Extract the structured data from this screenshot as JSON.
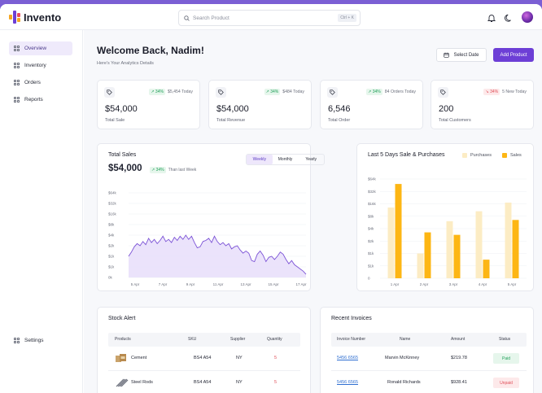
{
  "app": {
    "name": "Invento"
  },
  "search": {
    "placeholder": "Search Product",
    "shortcut": "Ctrl + K"
  },
  "sidebar": {
    "items": [
      {
        "label": "Overview",
        "icon": "grid-icon",
        "active": true
      },
      {
        "label": "Inventory",
        "icon": "grid-icon"
      },
      {
        "label": "Orders",
        "icon": "grid-icon"
      },
      {
        "label": "Reports",
        "icon": "grid-icon"
      }
    ],
    "settings": {
      "label": "Settings",
      "icon": "grid-icon"
    }
  },
  "header": {
    "title": "Welcome Back, Nadim!",
    "subtitle": "Here's Your Analytics Details",
    "select_date": "Select Date",
    "add_product": "Add Product"
  },
  "stats": [
    {
      "value": "$54,000",
      "label": "Total Sale",
      "trend": "34%",
      "direction": "up",
      "note": "$5,454 Today"
    },
    {
      "value": "$54,000",
      "label": "Total Revenue",
      "trend": "34%",
      "direction": "up",
      "note": "$484 Today"
    },
    {
      "value": "6,546",
      "label": "Total Order",
      "trend": "34%",
      "direction": "up",
      "note": "84 Orders Today"
    },
    {
      "value": "200",
      "label": "Total Customers",
      "trend": "34%",
      "direction": "down",
      "note": "5 New Today"
    }
  ],
  "total_sales": {
    "title": "Total Sales",
    "value": "$54,000",
    "trend": "34%",
    "trend_note": "Than last Week",
    "tabs": [
      "Weekly",
      "Monthly",
      "Yearly"
    ],
    "active_tab": "Weekly"
  },
  "bar_panel": {
    "title": "Last 5 Days Sale & Purchases",
    "legend": [
      "Purchases",
      "Sales"
    ]
  },
  "chart_data": [
    {
      "type": "area",
      "y_tick_labels": [
        "$64k",
        "$32k",
        "$16k",
        "$8k",
        "$4k",
        "$2k",
        "$1k",
        "$1k",
        "0k"
      ],
      "x_tick_labels": [
        "5 Apr",
        "7 Apr",
        "9 Apr",
        "11 Apr",
        "13 Apr",
        "15 Apr",
        "17 Apr"
      ],
      "y_scale": "categorical-log",
      "series": [
        {
          "values": [
            2.0,
            2.4,
            2.9,
            3.2,
            3.0,
            3.4,
            3.1,
            3.7,
            3.3,
            3.6,
            3.2,
            3.5,
            3.9,
            3.4,
            3.6,
            3.3,
            3.8,
            3.5,
            3.9,
            3.6,
            4.0,
            3.6,
            3.9,
            3.3,
            2.8,
            2.9,
            3.4,
            3.5,
            3.7,
            3.3,
            3.9,
            3.4,
            3.1,
            3.3,
            3.0,
            3.2,
            2.7,
            2.9,
            3.0,
            2.6,
            2.3,
            2.5,
            2.3,
            1.6,
            1.5,
            2.2,
            2.5,
            2.1,
            1.5,
            1.9,
            2.0,
            1.7,
            2.0,
            2.4,
            2.2,
            1.7,
            1.3,
            1.6,
            1.2,
            1.0,
            0.8,
            0.6,
            0.3
          ]
        }
      ],
      "line_color": "#7b52d6",
      "fill_color": "#e9e0fb"
    },
    {
      "type": "bar",
      "categories": [
        "1 Apr",
        "2 Apr",
        "3 Apr",
        "4 Apr",
        "5 Apr"
      ],
      "y_tick_labels": [
        "$64k",
        "$32k",
        "$16k",
        "$8k",
        "$4k",
        "$2k",
        "$1k",
        "$1k",
        "0"
      ],
      "y_scale": "categorical-log",
      "series": [
        {
          "name": "Purchases",
          "values": [
            5.7,
            2.0,
            4.6,
            5.4,
            6.1
          ],
          "color": "#fcecc4"
        },
        {
          "name": "Sales",
          "values": [
            7.6,
            3.7,
            3.5,
            1.5,
            4.7
          ],
          "color": "#fdb614"
        }
      ]
    }
  ],
  "stock": {
    "title": "Stock Alert",
    "columns": [
      "Products",
      "SKU",
      "Supplier",
      "Quantity"
    ],
    "rows": [
      {
        "product": "Cement",
        "sku": "BS4 A54",
        "supplier": "NY",
        "quantity": "5"
      },
      {
        "product": "Steel Rods",
        "sku": "BS4 A54",
        "supplier": "NY",
        "quantity": "5"
      }
    ]
  },
  "invoices": {
    "title": "Recent Invoices",
    "columns": [
      "Invoice Number",
      "Name",
      "Amount",
      "Status"
    ],
    "rows": [
      {
        "number": "5456 6565",
        "name": "Marvin McKinney",
        "amount": "$219.78",
        "status": "Paid"
      },
      {
        "number": "5456 6565",
        "name": "Ronald Richards",
        "amount": "$928.41",
        "status": "Unpaid"
      }
    ]
  },
  "colors": {
    "accent": "#6d3fd6",
    "sales": "#fdb614",
    "purchases": "#fcecc4",
    "paid": "#22a05a",
    "unpaid": "#e0505a"
  }
}
